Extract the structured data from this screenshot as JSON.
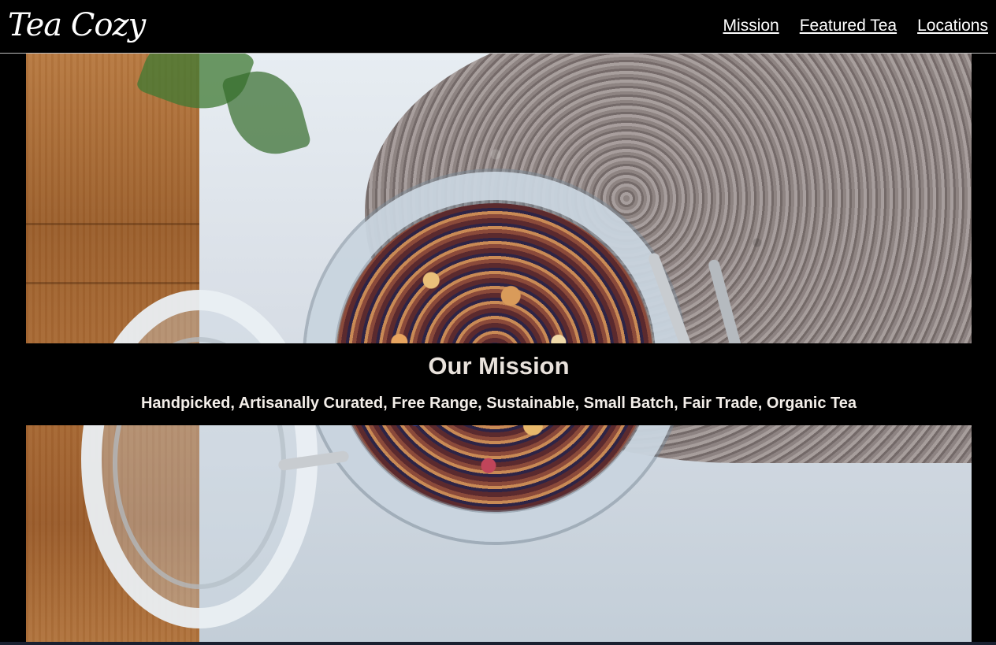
{
  "header": {
    "logo_text": "Tea Cozy",
    "nav": [
      {
        "label": "Mission"
      },
      {
        "label": "Featured Tea"
      },
      {
        "label": "Locations"
      }
    ]
  },
  "hero": {
    "image_description_icon": "tea-jar-photo"
  },
  "mission": {
    "title": "Our Mission",
    "text": "Handpicked, Artisanally Curated, Free Range, Sustainable, Small Batch, Fair Trade, Organic Tea"
  },
  "colors": {
    "background": "#000000",
    "nav_text": "#ffffff",
    "mission_title": "#e9e2dc",
    "mission_text": "#f3eee9"
  }
}
